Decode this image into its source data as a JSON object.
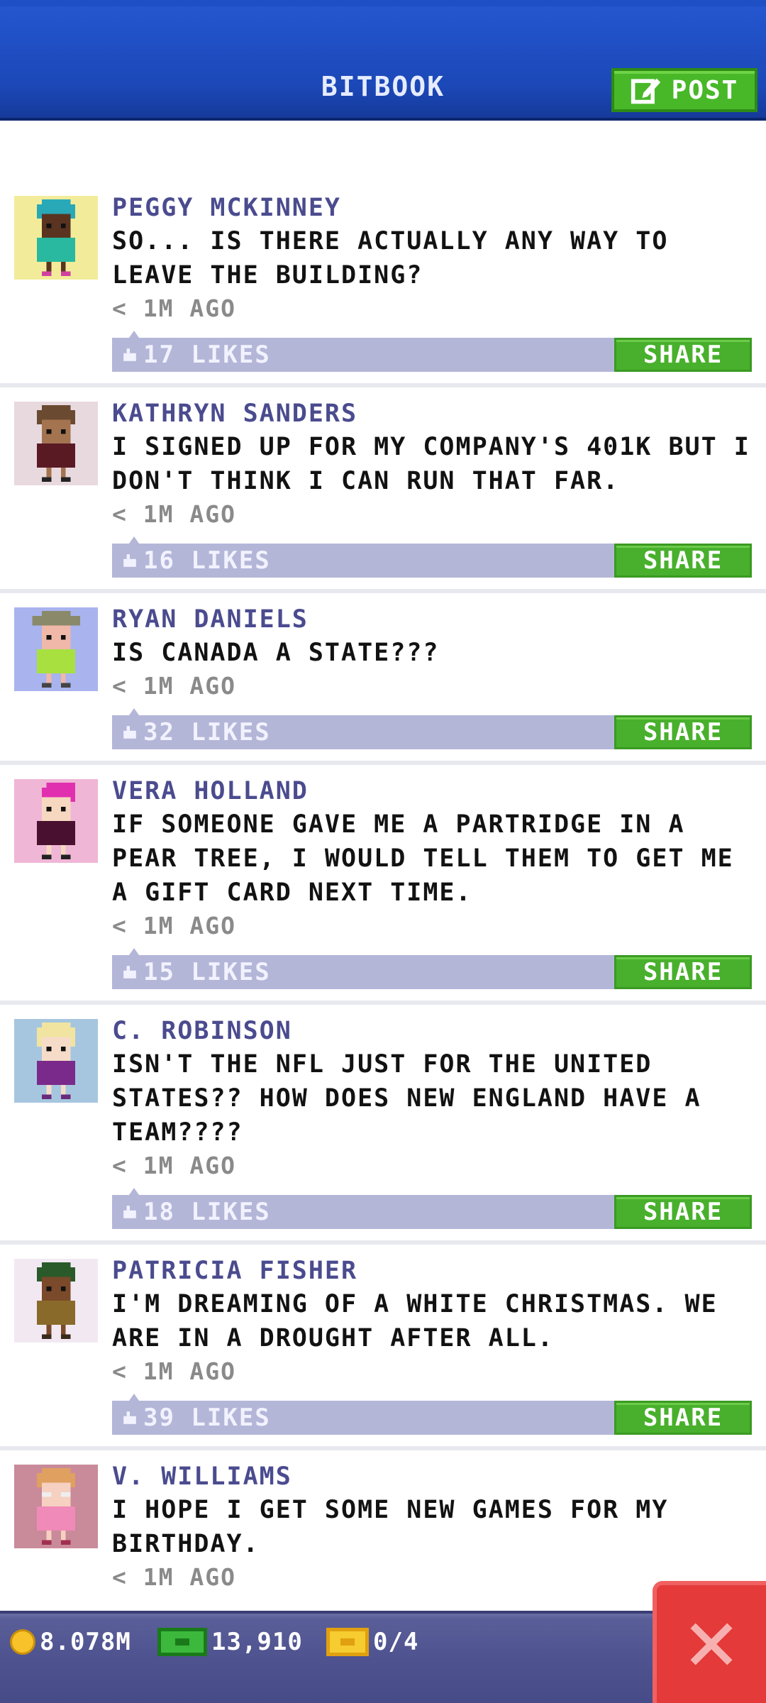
{
  "header": {
    "title": "BITBOOK",
    "post_label": "POST"
  },
  "posts": [
    {
      "author": "PEGGY MCKINNEY",
      "message": "SO... IS THERE ACTUALLY ANY WAY TO LEAVE THE BUILDING?",
      "time": "< 1M AGO",
      "likes": "17 LIKES",
      "share_label": "SHARE",
      "avatar_bg": "#f2ec9a"
    },
    {
      "author": "KATHRYN SANDERS",
      "message": "I SIGNED UP FOR MY COMPANY'S 401K BUT I DON'T THINK I CAN RUN THAT FAR.",
      "time": "< 1M AGO",
      "likes": "16 LIKES",
      "share_label": "SHARE",
      "avatar_bg": "#e8d9df"
    },
    {
      "author": "RYAN DANIELS",
      "message": "IS CANADA A STATE???",
      "time": "< 1M AGO",
      "likes": "32 LIKES",
      "share_label": "SHARE",
      "avatar_bg": "#a9b3ee"
    },
    {
      "author": "VERA HOLLAND",
      "message": "IF SOMEONE GAVE ME A PARTRIDGE IN A PEAR TREE, I WOULD TELL THEM TO GET ME A GIFT CARD NEXT TIME.",
      "time": "< 1M AGO",
      "likes": "15 LIKES",
      "share_label": "SHARE",
      "avatar_bg": "#f0b6d6"
    },
    {
      "author": "C. ROBINSON",
      "message": "ISN'T THE NFL JUST FOR THE UNITED STATES?? HOW DOES NEW ENGLAND HAVE A TEAM????",
      "time": "< 1M AGO",
      "likes": "18 LIKES",
      "share_label": "SHARE",
      "avatar_bg": "#a6c6e0"
    },
    {
      "author": "PATRICIA FISHER",
      "message": "I'M DREAMING OF A WHITE CHRISTMAS. WE ARE IN A DROUGHT AFTER ALL.",
      "time": "< 1M AGO",
      "likes": "39 LIKES",
      "share_label": "SHARE",
      "avatar_bg": "#f2e8f2"
    },
    {
      "author": "V. WILLIAMS",
      "message": "I HOPE I GET SOME NEW GAMES FOR MY BIRTHDAY.",
      "time": "< 1M AGO",
      "likes": "",
      "share_label": "",
      "avatar_bg": "#c98a9a"
    }
  ],
  "status_bar": {
    "coins": "8.078M",
    "bux": "13,910",
    "tickets": "0/4"
  },
  "icons": {
    "post": "edit-icon",
    "like": "thumbs-up-icon",
    "coin": "coin-icon",
    "bux": "bux-cash-icon",
    "ticket": "ticket-icon",
    "close": "close-icon"
  },
  "colors": {
    "header_blue": "#1c48b8",
    "accent_green": "#48b02c",
    "like_bar": "#b4b6d8",
    "author_text": "#4b4b8f",
    "close_red": "#e43a3a"
  }
}
